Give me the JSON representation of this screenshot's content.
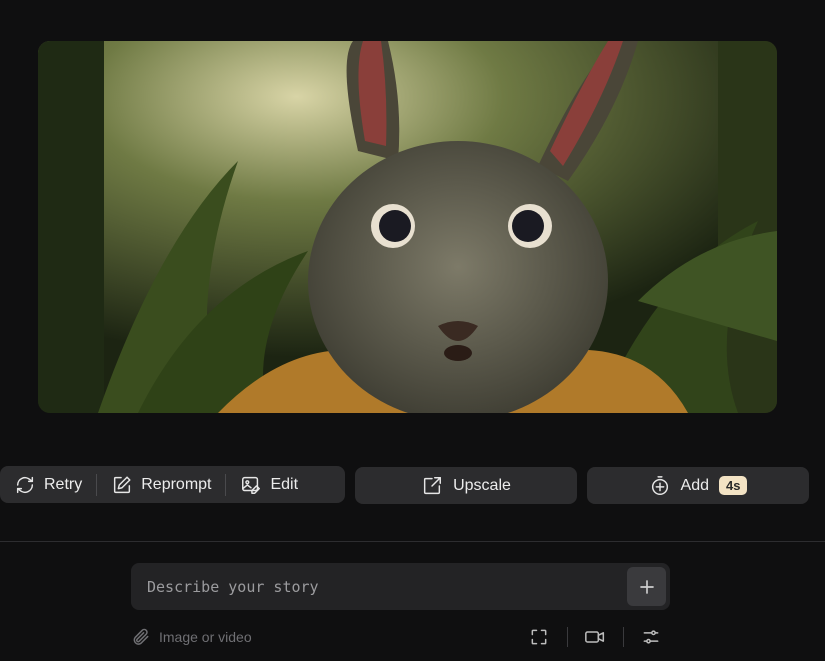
{
  "preview": {
    "alt": "rabbit-in-jungle-video-frame"
  },
  "actions": {
    "retry_label": "Retry",
    "reprompt_label": "Reprompt",
    "edit_label": "Edit",
    "upscale_label": "Upscale",
    "add_label": "Add",
    "add_badge": "4s"
  },
  "composer": {
    "placeholder": "Describe your story",
    "attach_label": "Image or video"
  },
  "colors": {
    "background": "#0f0f10",
    "button": "#2c2c2e",
    "badge": "#f3e3c4"
  }
}
